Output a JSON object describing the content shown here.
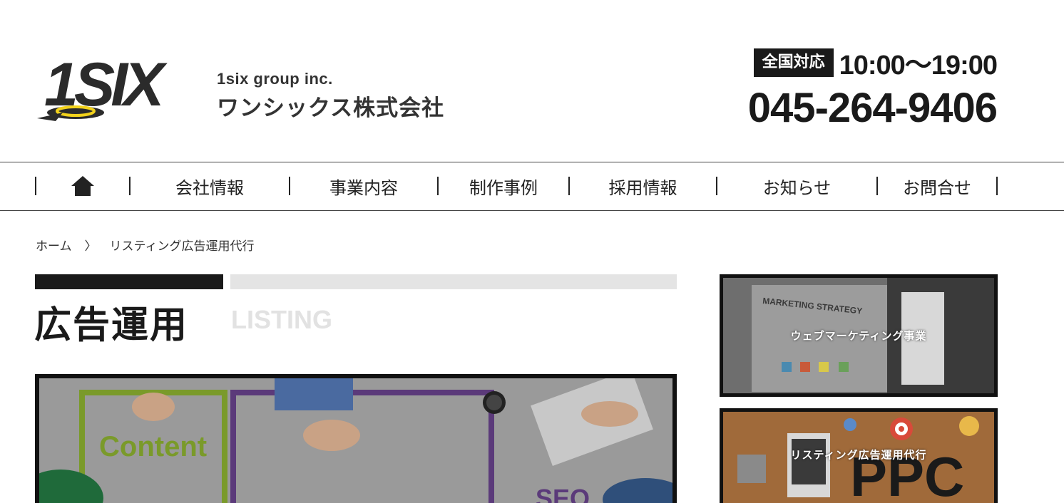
{
  "header": {
    "logo_mark": "1SIX",
    "company_en": "1six group inc.",
    "company_jp": "ワンシックス株式会社",
    "badge": "全国対応",
    "hours": "10:00〜19:00",
    "phone": "045-264-9406"
  },
  "nav": {
    "home_icon": "home-icon",
    "items": [
      "会社情報",
      "事業内容",
      "制作事例",
      "採用情報",
      "お知らせ",
      "お問合せ"
    ]
  },
  "breadcrumb": {
    "home": "ホーム",
    "separator": "〉",
    "current": "リスティング広告運用代行"
  },
  "main": {
    "title": "広告運用",
    "subtitle": "LISTING",
    "hero_labels": [
      "Content",
      "SEO"
    ]
  },
  "sidebar": {
    "cards": [
      {
        "caption": "ウェブマーケティング事業",
        "image_text": "MARKETING STRATEGY"
      },
      {
        "caption": "リスティング広告運用代行",
        "image_text": "PPC"
      }
    ]
  },
  "colors": {
    "dark": "#1a1a1a",
    "light_bar": "#e4e4e4",
    "accent_yellow": "#f2d21b"
  }
}
